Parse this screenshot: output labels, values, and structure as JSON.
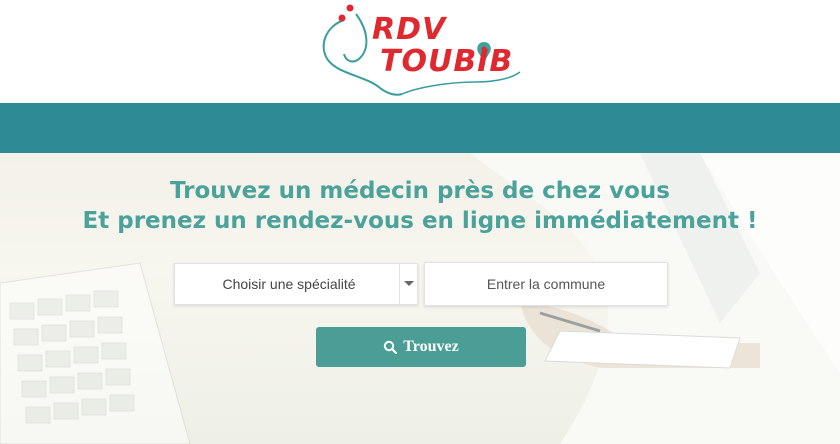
{
  "logo": {
    "line1": "RDV",
    "line2": "TOUBIB",
    "brand_red": "#e0282f",
    "brand_teal": "#2e8a95"
  },
  "hero": {
    "headline_1": "Trouvez un médecin près de chez vous",
    "headline_2": "Et prenez un rendez-vous en ligne immédiatement !",
    "heading_color": "#4aa29a"
  },
  "search": {
    "specialty_selected": "Choisir une spécialité",
    "commune_placeholder": "Entrer la commune",
    "button_label": "Trouvez",
    "button_icon": "search-icon",
    "button_color": "#4a9e96"
  }
}
